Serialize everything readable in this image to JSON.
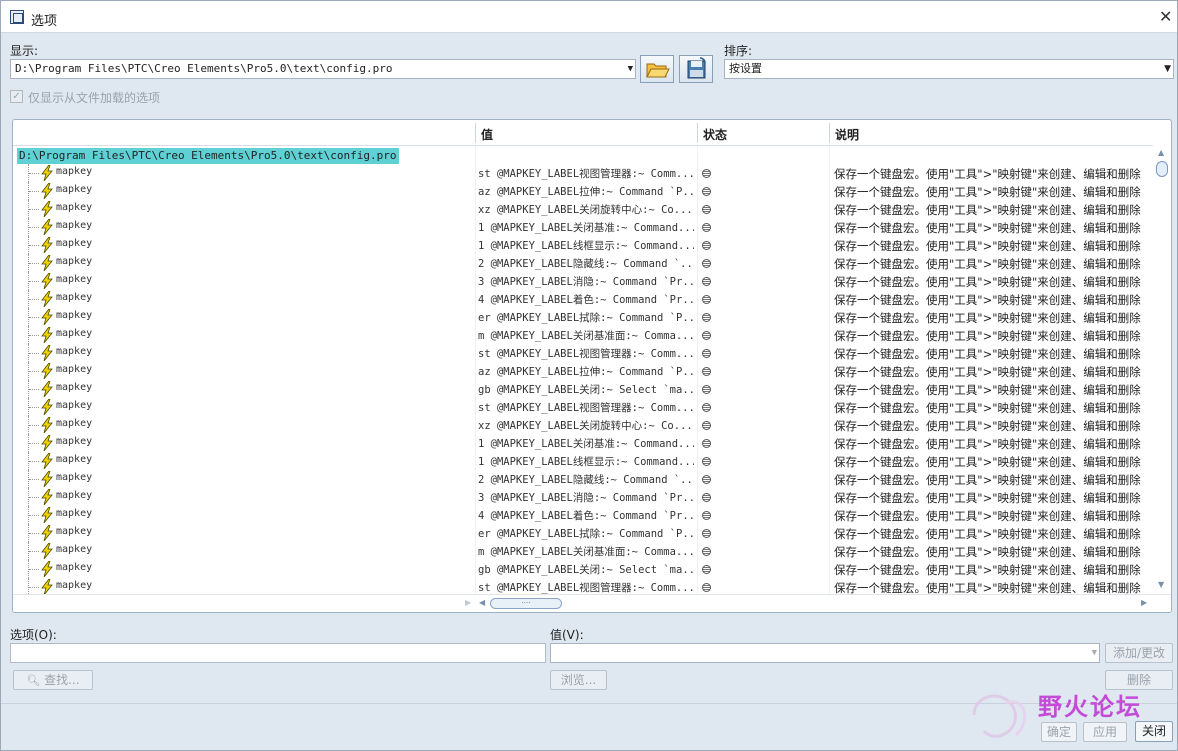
{
  "window": {
    "title": "选项"
  },
  "display": {
    "label": "显示:",
    "path": "D:\\Program Files\\PTC\\Creo Elements\\Pro5.0\\text\\config.pro"
  },
  "sort": {
    "label": "排序:",
    "value": "按设置"
  },
  "checkbox_label": "仅显示从文件加载的选项",
  "columns": {
    "value": "值",
    "status": "状态",
    "desc": "说明"
  },
  "root_label": "D:\\Program Files\\PTC\\Creo Elements\\Pro5.0\\text\\config.pro",
  "rows": [
    {
      "name": "mapkey",
      "value": "st @MAPKEY_LABEL视图管理器:~ Comm...",
      "desc": "保存一个键盘宏。使用\"工具\">\"映射键\"来创建、编辑和删除"
    },
    {
      "name": "mapkey",
      "value": "az @MAPKEY_LABEL拉伸:~ Command `P...",
      "desc": "保存一个键盘宏。使用\"工具\">\"映射键\"来创建、编辑和删除"
    },
    {
      "name": "mapkey",
      "value": "xz @MAPKEY_LABEL关闭旋转中心:~ Co...",
      "desc": "保存一个键盘宏。使用\"工具\">\"映射键\"来创建、编辑和删除"
    },
    {
      "name": "mapkey",
      "value": "1 @MAPKEY_LABEL关闭基准:~ Command...",
      "desc": "保存一个键盘宏。使用\"工具\">\"映射键\"来创建、编辑和删除"
    },
    {
      "name": "mapkey",
      "value": "1 @MAPKEY_LABEL线框显示:~ Command...",
      "desc": "保存一个键盘宏。使用\"工具\">\"映射键\"来创建、编辑和删除"
    },
    {
      "name": "mapkey",
      "value": "2 @MAPKEY_LABEL隐藏线:~ Command `...",
      "desc": "保存一个键盘宏。使用\"工具\">\"映射键\"来创建、编辑和删除"
    },
    {
      "name": "mapkey",
      "value": "3 @MAPKEY_LABEL消隐:~ Command `Pr...",
      "desc": "保存一个键盘宏。使用\"工具\">\"映射键\"来创建、编辑和删除"
    },
    {
      "name": "mapkey",
      "value": "4 @MAPKEY_LABEL着色:~ Command `Pr...",
      "desc": "保存一个键盘宏。使用\"工具\">\"映射键\"来创建、编辑和删除"
    },
    {
      "name": "mapkey",
      "value": "er @MAPKEY_LABEL拭除:~ Command `P...",
      "desc": "保存一个键盘宏。使用\"工具\">\"映射键\"来创建、编辑和删除"
    },
    {
      "name": "mapkey",
      "value": "m @MAPKEY_LABEL关闭基准面:~ Comma...",
      "desc": "保存一个键盘宏。使用\"工具\">\"映射键\"来创建、编辑和删除"
    },
    {
      "name": "mapkey",
      "value": "st @MAPKEY_LABEL视图管理器:~ Comm...",
      "desc": "保存一个键盘宏。使用\"工具\">\"映射键\"来创建、编辑和删除"
    },
    {
      "name": "mapkey",
      "value": "az @MAPKEY_LABEL拉伸:~ Command `P...",
      "desc": "保存一个键盘宏。使用\"工具\">\"映射键\"来创建、编辑和删除"
    },
    {
      "name": "mapkey",
      "value": "gb @MAPKEY_LABEL关闭:~ Select `ma...",
      "desc": "保存一个键盘宏。使用\"工具\">\"映射键\"来创建、编辑和删除"
    },
    {
      "name": "mapkey",
      "value": "st @MAPKEY_LABEL视图管理器:~ Comm...",
      "desc": "保存一个键盘宏。使用\"工具\">\"映射键\"来创建、编辑和删除"
    },
    {
      "name": "mapkey",
      "value": "xz @MAPKEY_LABEL关闭旋转中心:~ Co...",
      "desc": "保存一个键盘宏。使用\"工具\">\"映射键\"来创建、编辑和删除"
    },
    {
      "name": "mapkey",
      "value": "1 @MAPKEY_LABEL关闭基准:~ Command...",
      "desc": "保存一个键盘宏。使用\"工具\">\"映射键\"来创建、编辑和删除"
    },
    {
      "name": "mapkey",
      "value": "1 @MAPKEY_LABEL线框显示:~ Command...",
      "desc": "保存一个键盘宏。使用\"工具\">\"映射键\"来创建、编辑和删除"
    },
    {
      "name": "mapkey",
      "value": "2 @MAPKEY_LABEL隐藏线:~ Command `...",
      "desc": "保存一个键盘宏。使用\"工具\">\"映射键\"来创建、编辑和删除"
    },
    {
      "name": "mapkey",
      "value": "3 @MAPKEY_LABEL消隐:~ Command `Pr...",
      "desc": "保存一个键盘宏。使用\"工具\">\"映射键\"来创建、编辑和删除"
    },
    {
      "name": "mapkey",
      "value": "4 @MAPKEY_LABEL着色:~ Command `Pr...",
      "desc": "保存一个键盘宏。使用\"工具\">\"映射键\"来创建、编辑和删除"
    },
    {
      "name": "mapkey",
      "value": "er @MAPKEY_LABEL拭除:~ Command `P...",
      "desc": "保存一个键盘宏。使用\"工具\">\"映射键\"来创建、编辑和删除"
    },
    {
      "name": "mapkey",
      "value": "m @MAPKEY_LABEL关闭基准面:~ Comma...",
      "desc": "保存一个键盘宏。使用\"工具\">\"映射键\"来创建、编辑和删除"
    },
    {
      "name": "mapkey",
      "value": "gb @MAPKEY_LABEL关闭:~ Select `ma...",
      "desc": "保存一个键盘宏。使用\"工具\">\"映射键\"来创建、编辑和删除"
    },
    {
      "name": "mapkey",
      "value": "st @MAPKEY_LABEL视图管理器:~ Comm...",
      "desc": "保存一个键盘宏。使用\"工具\">\"映射键\"来创建、编辑和删除"
    }
  ],
  "option_field": {
    "label": "选项(O):",
    "value": ""
  },
  "value_field": {
    "label": "值(V):",
    "value": ""
  },
  "buttons": {
    "add_change": "添加/更改",
    "find": "查找...",
    "browse": "浏览...",
    "delete": "删除",
    "ok": "确定",
    "apply": "应用",
    "close": "关闭"
  },
  "watermark": {
    "title": "野火论坛"
  }
}
